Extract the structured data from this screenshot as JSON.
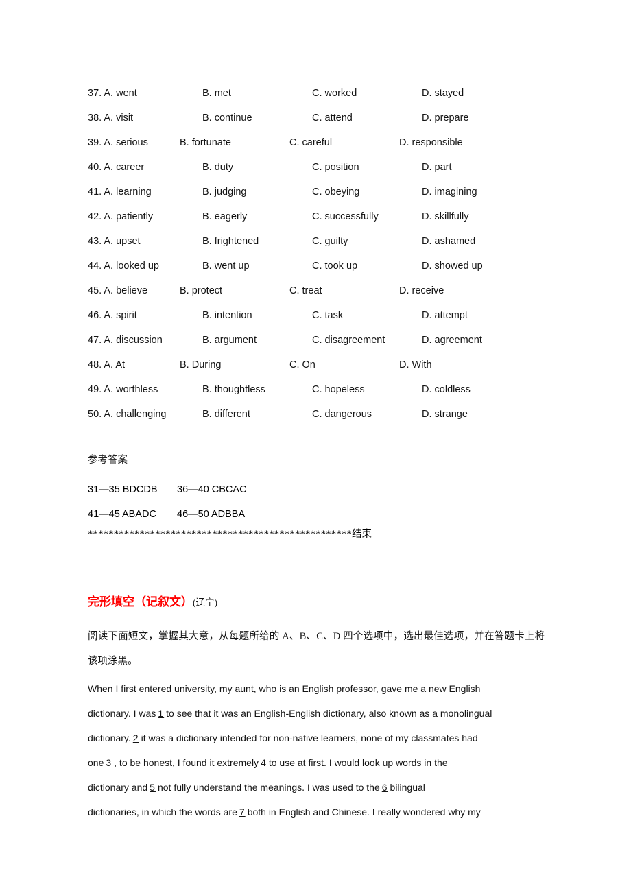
{
  "options": {
    "rows": [
      {
        "num": "37",
        "a": "A. went",
        "b": "B. met",
        "c": "C. worked",
        "d": "D. stayed",
        "shift": false
      },
      {
        "num": "38",
        "a": "A. visit",
        "b": "B. continue",
        "c": "C. attend",
        "d": "D. prepare",
        "shift": false
      },
      {
        "num": "39",
        "a": "A. serious",
        "b": "B. fortunate",
        "c": "C. careful",
        "d": "D. responsible",
        "shift": true
      },
      {
        "num": "40",
        "a": "A. career",
        "b": "B. duty",
        "c": "C. position",
        "d": "D. part",
        "shift": false
      },
      {
        "num": "41",
        "a": "A. learning",
        "b": "B. judging",
        "c": "C. obeying",
        "d": "D. imagining",
        "shift": false
      },
      {
        "num": "42",
        "a": "A. patiently",
        "b": "B. eagerly",
        "c": "C. successfully",
        "d": "D. skillfully",
        "shift": false
      },
      {
        "num": "43",
        "a": "A. upset",
        "b": "B. frightened",
        "c": "C. guilty",
        "d": "D. ashamed",
        "shift": false
      },
      {
        "num": "44",
        "a": "A. looked up",
        "b": "B. went up",
        "c": "C. took up",
        "d": "D. showed up",
        "shift": false
      },
      {
        "num": "45",
        "a": "A. believe",
        "b": "B. protect",
        "c": "C. treat",
        "d": "D. receive",
        "shift": true
      },
      {
        "num": "46",
        "a": "A. spirit",
        "b": "B. intention",
        "c": "C. task",
        "d": "D. attempt",
        "shift": false
      },
      {
        "num": "47",
        "a": "A. discussion",
        "b": "B. argument",
        "c": "C. disagreement",
        "d": "D. agreement",
        "shift": false
      },
      {
        "num": "48",
        "a": "A. At",
        "b": "B. During",
        "c": "C. On",
        "d": "D. With",
        "shift": true
      },
      {
        "num": "49",
        "a": "A. worthless",
        "b": "B. thoughtless",
        "c": "C. hopeless",
        "d": "D. coldless",
        "shift": false
      },
      {
        "num": "50",
        "a": "A. challenging",
        "b": "B. different",
        "c": "C. dangerous",
        "d": "D. strange",
        "shift": false
      }
    ]
  },
  "answer_key": {
    "title": "参考答案",
    "lines": [
      {
        "left": "31—35 BDCDB",
        "right": "36—40 CBCAC"
      },
      {
        "left": "41—45 ABADC",
        "right": "46—50 ADBBA"
      }
    ]
  },
  "divider": {
    "stars": "***************************************************",
    "end_label": "结束"
  },
  "section": {
    "heading_main": "完形填空（记叙文）",
    "heading_sub": "(辽宁)",
    "heading_color": "#ff0000"
  },
  "instruction": {
    "text": "阅读下面短文，掌握其大意，从每题所给的 A、B、C、D 四个选项中，选出最佳选项，并在答题卡上将该项涂黑。"
  },
  "passage": {
    "lines": [
      [
        {
          "t": "text",
          "v": "When I first entered university, my aunt, who is an English professor, gave me a new English"
        }
      ],
      [
        {
          "t": "text",
          "v": "dictionary. I was"
        },
        {
          "t": "blank",
          "v": "1"
        },
        {
          "t": "text",
          "v": "to see that it was an English-English dictionary, also known as a monolingual"
        }
      ],
      [
        {
          "t": "text",
          "v": "dictionary."
        },
        {
          "t": "blank",
          "v": "2"
        },
        {
          "t": "text",
          "v": "it was a dictionary intended for non-native learners, none of my classmates had"
        }
      ],
      [
        {
          "t": "text",
          "v": "one"
        },
        {
          "t": "blank",
          "v": "3"
        },
        {
          "t": "text",
          "v": ", to be honest, I found it extremely"
        },
        {
          "t": "blank",
          "v": "4"
        },
        {
          "t": "text",
          "v": "to use at first. I would look up words in the"
        }
      ],
      [
        {
          "t": "text",
          "v": "dictionary and"
        },
        {
          "t": "blank",
          "v": "5"
        },
        {
          "t": "text",
          "v": "not fully understand the meanings. I was used to the"
        },
        {
          "t": "blank",
          "v": "6"
        },
        {
          "t": "text",
          "v": "bilingual"
        }
      ],
      [
        {
          "t": "text",
          "v": "dictionaries, in which the words are"
        },
        {
          "t": "blank",
          "v": "7"
        },
        {
          "t": "text",
          "v": "both in English and Chinese. I really wondered why my"
        }
      ]
    ]
  }
}
